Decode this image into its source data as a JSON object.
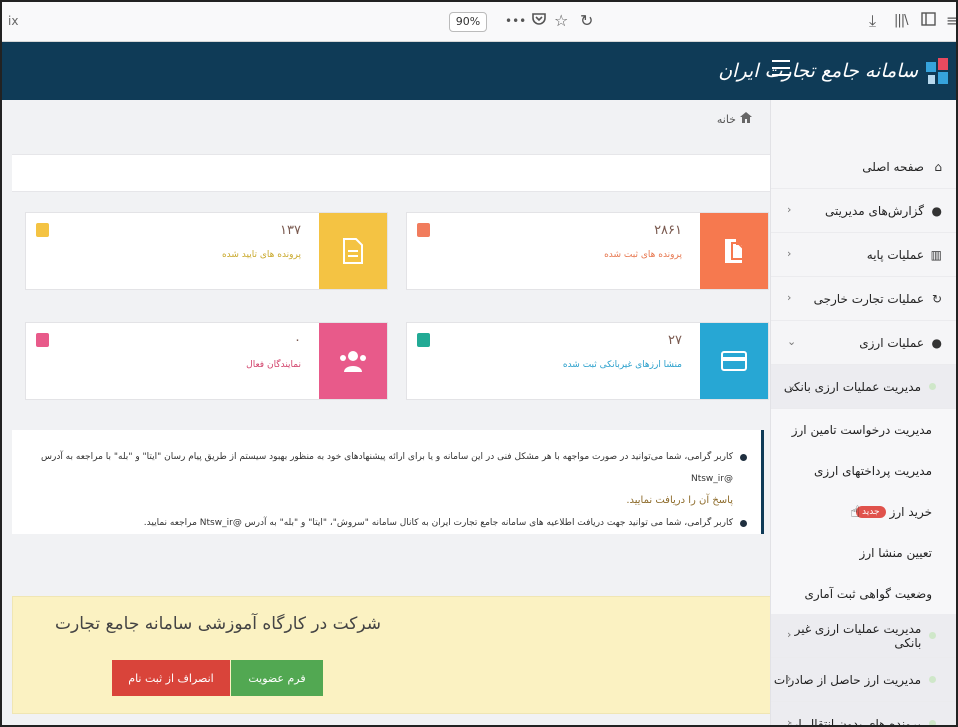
{
  "browser": {
    "url_tail": "ix",
    "zoom": "90%",
    "icons": [
      "more-icon",
      "pocket-icon",
      "bookmark-star-icon",
      "reload-icon",
      "download-icon",
      "library-icon",
      "sidebar-toggle-icon",
      "menu-icon"
    ]
  },
  "header": {
    "brand_title": "سامانه جامع تجارت ایران",
    "colors": {
      "bar": "#0f3b57"
    }
  },
  "breadcrumb": {
    "home_label": "خانه"
  },
  "sidebar": {
    "items": [
      {
        "icon": "home-icon",
        "label": "صفحه اصلی",
        "chevron": ""
      },
      {
        "icon": "user-icon",
        "label": "گزارش‌های مدیریتی",
        "chevron": "‹"
      },
      {
        "icon": "chart-icon",
        "label": "عملیات پایه",
        "chevron": "‹"
      },
      {
        "icon": "refresh-icon",
        "label": "عملیات تجارت خارجی",
        "chevron": "‹"
      },
      {
        "icon": "user-plus-icon",
        "label": "عملیات ارزی",
        "chevron": "⌄"
      }
    ],
    "sub_group": {
      "label": "مدیریت عملیات ارزی بانکی",
      "chevron": "⌄"
    },
    "leaves": [
      "مدیریت درخواست تامین ارز",
      "مدیریت پرداختهای ارزی",
      "خرید ارز",
      "تعیین منشا ارز",
      "وضعیت گواهی ثبت آماری"
    ],
    "new_badge": "جدید",
    "bottom_items": [
      {
        "label": "مدیریت عملیات ارزی غیر بانکی",
        "chevron": "‹"
      },
      {
        "label": "مدیریت ارز حاصل از صادرات",
        "chevron": "‹"
      },
      {
        "label": "پرونده های بدون انتقال ارز",
        "chevron": "‹"
      }
    ]
  },
  "stats": [
    {
      "id": "registered",
      "value": "۲۸۶۱",
      "label": "پرونده های ثبت شده",
      "icon": "file-icon",
      "color": "#f6794f",
      "label_color": "#e7774f",
      "mini_color": "#f17c5d"
    },
    {
      "id": "confirmed",
      "value": "۱۳۷",
      "label": "پرونده های تایید شده",
      "icon": "document-icon",
      "color": "#f4c343",
      "label_color": "#c9a92d",
      "mini_color": "#f4c343"
    },
    {
      "id": "origins",
      "value": "۲۷",
      "label": "منشا ارزهای غیربانکی ثبت شده",
      "icon": "card-icon",
      "color": "#27a7d4",
      "label_color": "#2aa0cc",
      "mini_color": "#22aa95"
    },
    {
      "id": "reps",
      "value": "۰",
      "label": "نمایندگان فعال",
      "icon": "users-icon",
      "color": "#e85a8a",
      "label_color": "#d2446c",
      "mini_color": "#e85a8a"
    }
  ],
  "notices": [
    "کاربر گرامی، شما می‌توانید در صورت مواجهه با هر مشکل فنی در این سامانه و یا برای ارائه پیشنهادهای خود به منظور بهبود سیستم از طریق پیام رسان \"ایتا\" و \"بله\" با مراجعه به آدرس @Ntsw_ir",
    "پاسخ آن را دریافت نمایید.",
    "کاربر گرامی، شما می توانید جهت دریافت اطلاعیه های سامانه جامع تجارت ایران به کانال سامانه \"سروش\"، \"ایتا\" و \"بله\" به آدرس @Ntsw_ir مراجعه نمایید."
  ],
  "workshop": {
    "title": "شرکت در کارگاه آموزشی سامانه جامع تجارت",
    "membership_button": "فرم عضویت",
    "cancel_button": "انصراف از ثبت نام"
  }
}
